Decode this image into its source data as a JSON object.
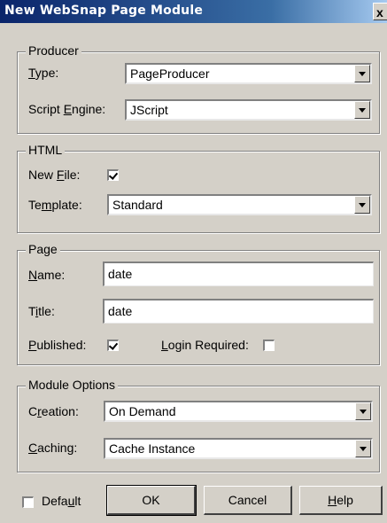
{
  "window": {
    "title": "New WebSnap Page Module",
    "close_glyph": "x"
  },
  "producer": {
    "legend": "Producer",
    "type_label": "Type:",
    "type_value": "PageProducer",
    "engine_label": "Script Engine:",
    "engine_value": "JScript"
  },
  "html": {
    "legend": "HTML",
    "newfile_label": "New File:",
    "newfile_checked": true,
    "template_label": "Template:",
    "template_value": "Standard"
  },
  "page": {
    "legend": "Page",
    "name_label": "Name:",
    "name_value": "date",
    "title_label": "Title:",
    "title_value": "date",
    "published_label": "Published:",
    "published_checked": true,
    "login_label": "Login Required:",
    "login_checked": false
  },
  "module_options": {
    "legend": "Module Options",
    "creation_label": "Creation:",
    "creation_value": "On Demand",
    "caching_label": "Caching:",
    "caching_value": "Cache Instance"
  },
  "footer": {
    "default_label": "Default",
    "default_checked": false,
    "ok_label": "OK",
    "cancel_label": "Cancel",
    "help_label": "Help"
  }
}
